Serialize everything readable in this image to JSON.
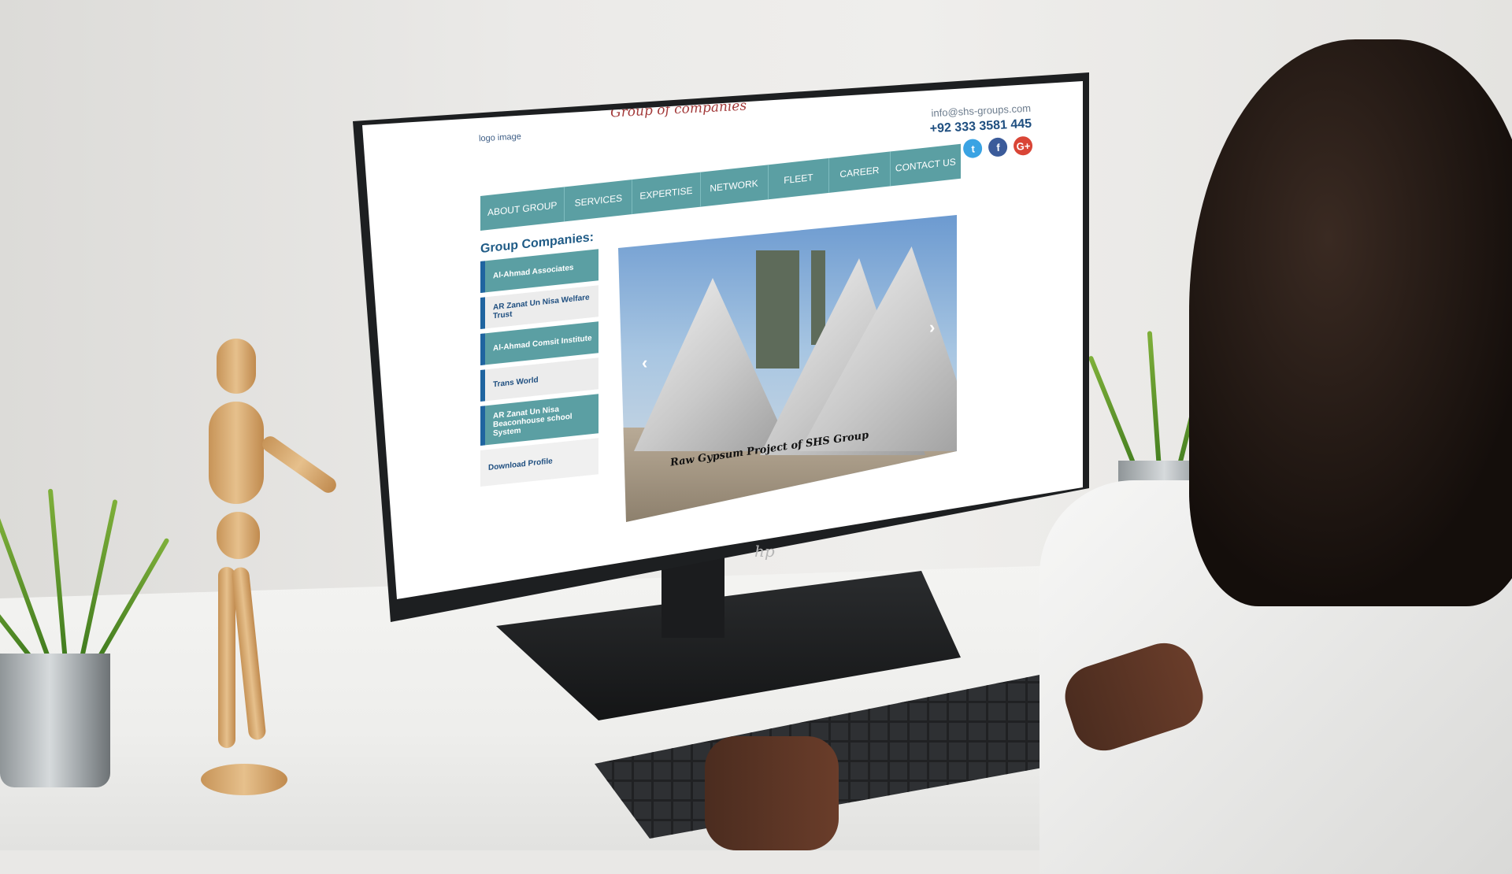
{
  "site": {
    "tagline": "Group of companies",
    "logo_placeholder": "logo image",
    "email": "info@shs-groups.com",
    "phone": "+92 333 3581 445",
    "social": [
      {
        "icon": "twitter-icon",
        "glyph": "t"
      },
      {
        "icon": "facebook-icon",
        "glyph": "f"
      },
      {
        "icon": "google-plus-icon",
        "glyph": "G+"
      }
    ],
    "nav": [
      "ABOUT GROUP",
      "SERVICES",
      "EXPERTISE",
      "NETWORK",
      "FLEET",
      "CAREER",
      "CONTACT US"
    ],
    "sidebar": {
      "title": "Group Companies:",
      "items": [
        {
          "label": "Al-Ahmad Associates",
          "style": "teal"
        },
        {
          "label": "AR Zanat Un Nisa Welfare Trust",
          "style": "light"
        },
        {
          "label": "Al-Ahmad Comsit Institute",
          "style": "teal"
        },
        {
          "label": "Trans World",
          "style": "light"
        },
        {
          "label": "AR Zanat Un Nisa Beaconhouse school System",
          "style": "teal"
        }
      ],
      "download": "Download Profile"
    },
    "slider": {
      "caption": "Raw Gypsum Project of SHS Group",
      "prev_glyph": "‹",
      "next_glyph": "›"
    }
  },
  "device": {
    "brand": "hp"
  },
  "colors": {
    "nav_teal": "#5b9fa3",
    "accent_blue": "#1f64a0",
    "tagline_red": "#a33a3a"
  }
}
